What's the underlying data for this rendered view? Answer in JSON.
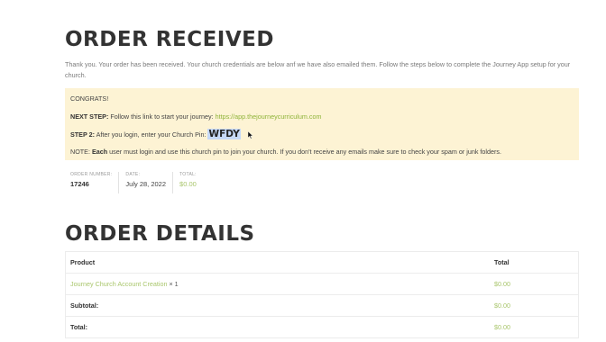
{
  "page": {
    "title_received": "ORDER RECEIVED",
    "intro": "Thank you. Your order has been received. Your church credentials are below anf we have also emailed them. Follow the steps below to complete the Journey App setup for your church.",
    "title_details": "ORDER DETAILS"
  },
  "notice": {
    "congrats": "CONGRATS!",
    "next_step_label": "NEXT STEP:",
    "next_step_text": " Follow this link to start your journey: ",
    "journey_link": "https://app.thejourneycurriculum.com",
    "step2_label": "STEP 2:",
    "step2_text": " After you login, enter your Church Pin: ",
    "church_pin": "WFDY",
    "note_prefix": "NOTE: ",
    "note_bold": "Each",
    "note_text": " user must login and use this church pin to join your church. If you don't receive any emails make sure to check your spam or junk folders."
  },
  "order_meta": [
    {
      "label": "ORDER NUMBER:",
      "value": "17246"
    },
    {
      "label": "DATE:",
      "value": "July 28, 2022"
    },
    {
      "label": "TOTAL:",
      "value": "$0.00"
    }
  ],
  "order_table": {
    "headers": [
      "Product",
      "Total"
    ],
    "item": {
      "name": "Journey Church Account Creation",
      "qty": " × 1",
      "total": "$0.00"
    },
    "subtotal": {
      "label": "Subtotal:",
      "value": "$0.00"
    },
    "total": {
      "label": "Total:",
      "value": "$0.00"
    }
  },
  "colors": {
    "link_green": "#8fb43a",
    "notice_bg": "#fdf3d4",
    "pin_highlight": "#c6d9f7"
  },
  "icons": {
    "cursor": "mouse-pointer-icon"
  }
}
